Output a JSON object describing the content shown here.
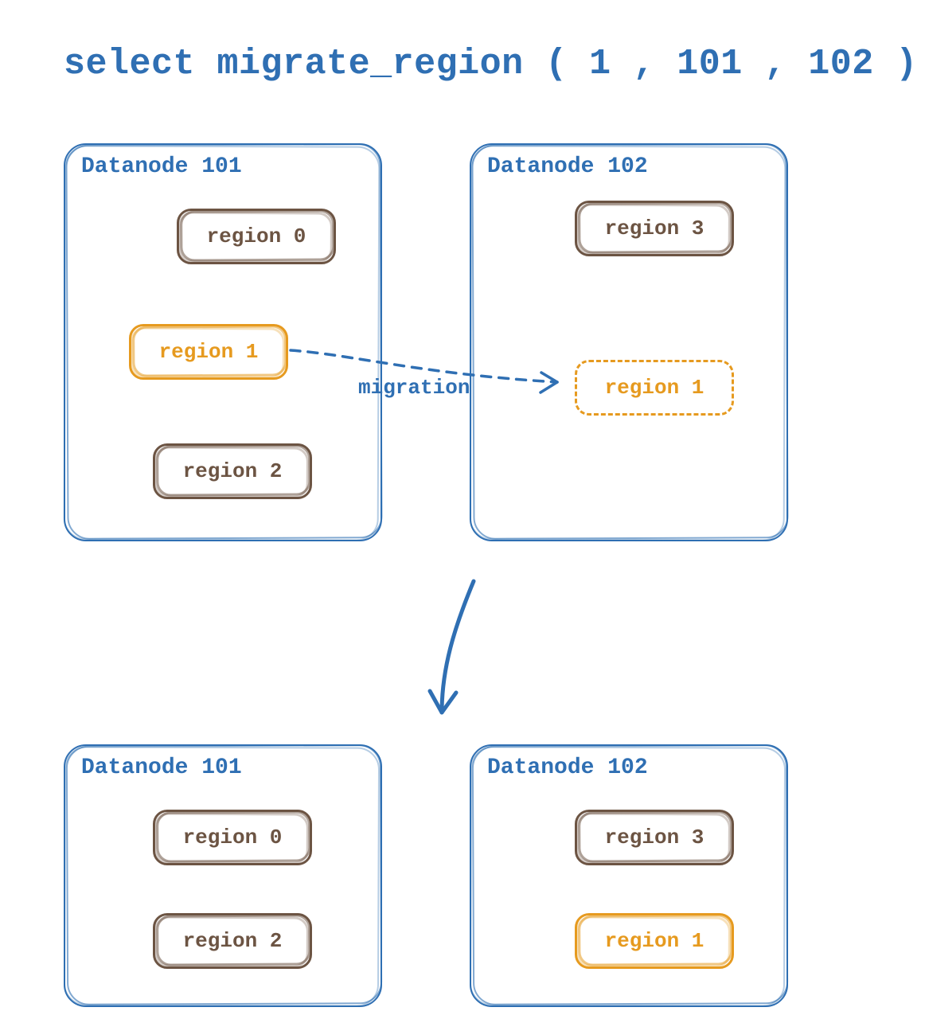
{
  "colors": {
    "blue": "#2f6fb3",
    "brown": "#6c5443",
    "orange": "#e69a1f"
  },
  "command": {
    "keyword": "select",
    "func": "migrate_region",
    "open": "(",
    "arg1": "1",
    "comma1": ", ",
    "arg2": "101",
    "comma2": ", ",
    "arg3": "102",
    "close": ")",
    "semi": ";"
  },
  "migration_label": "migration",
  "before": {
    "node_left": {
      "title": "Datanode 101",
      "regions": [
        {
          "label": "region 0",
          "style": "brown"
        },
        {
          "label": "region 1",
          "style": "orange"
        },
        {
          "label": "region 2",
          "style": "brown"
        }
      ]
    },
    "node_right": {
      "title": "Datanode 102",
      "regions": [
        {
          "label": "region 3",
          "style": "brown"
        },
        {
          "label": "region 1",
          "style": "orange-dashed"
        }
      ]
    }
  },
  "after": {
    "node_left": {
      "title": "Datanode 101",
      "regions": [
        {
          "label": "region 0",
          "style": "brown"
        },
        {
          "label": "region 2",
          "style": "brown"
        }
      ]
    },
    "node_right": {
      "title": "Datanode 102",
      "regions": [
        {
          "label": "region 3",
          "style": "brown"
        },
        {
          "label": "region 1",
          "style": "orange"
        }
      ]
    }
  }
}
